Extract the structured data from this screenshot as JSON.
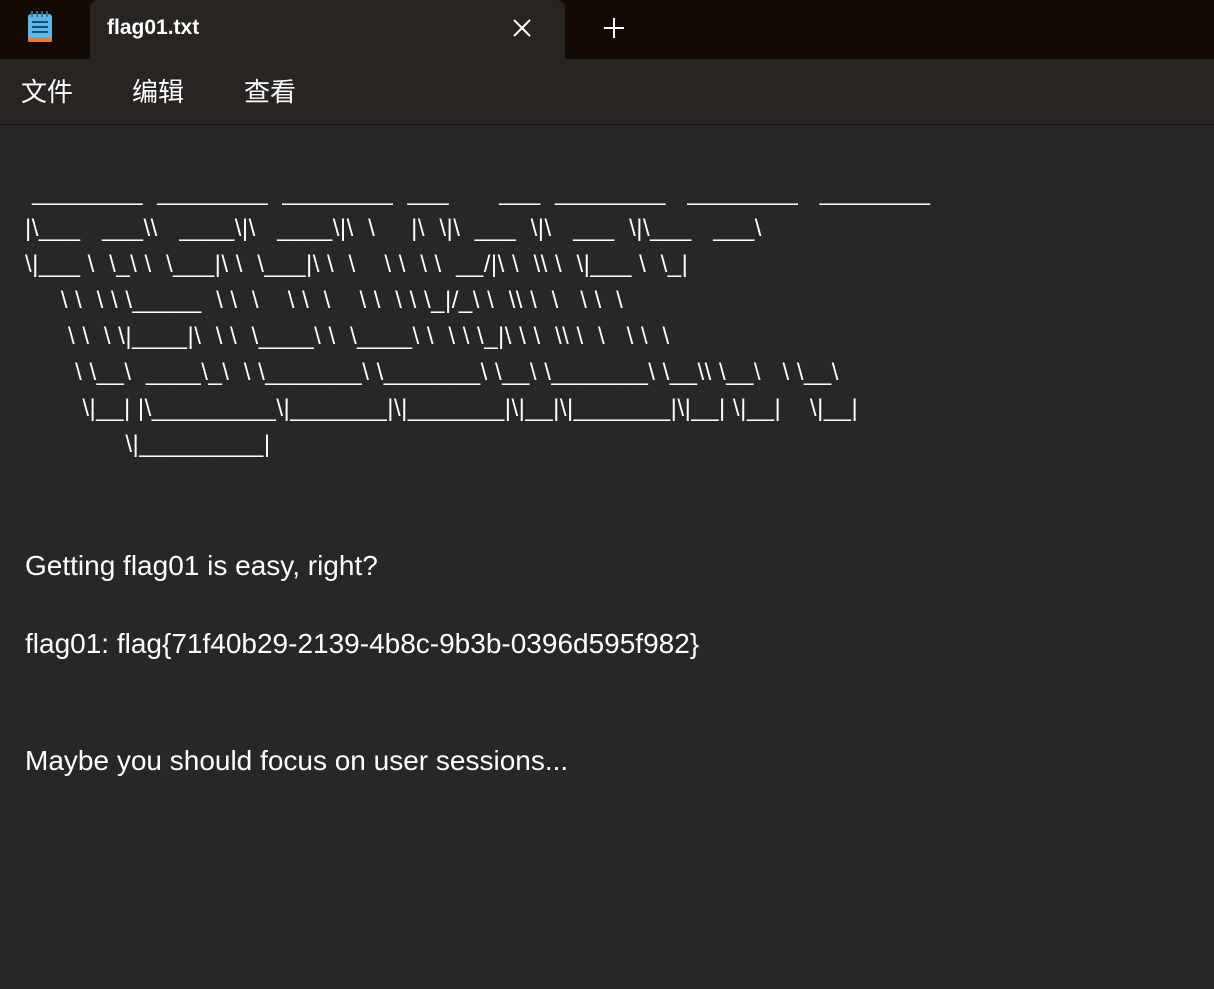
{
  "tab": {
    "title": "flag01.txt",
    "close_icon": "close-icon",
    "new_tab_icon": "plus-icon"
  },
  "menu": {
    "file": "文件",
    "edit": "编辑",
    "view": "查看"
  },
  "document": {
    "ascii_art": " ________  ________  ________  ___       ___  ________   ________   ________\n|\\___   ___\\\\   ____\\|\\   ____\\|\\  \\     |\\  \\|\\  ___  \\|\\   ___  \\|\\___   ___\\\n\\|___ \\  \\_\\ \\  \\___|\\ \\  \\___|\\ \\  \\    \\ \\  \\ \\  __/|\\ \\  \\\\ \\  \\|___ \\  \\_|\n     \\ \\  \\ \\ \\_____  \\ \\  \\    \\ \\  \\    \\ \\  \\ \\ \\_|/_\\ \\  \\\\ \\  \\   \\ \\  \\\n      \\ \\  \\ \\|____|\\  \\ \\  \\____\\ \\  \\____\\ \\  \\ \\ \\_|\\ \\ \\  \\\\ \\  \\   \\ \\  \\\n       \\ \\__\\  ____\\_\\  \\ \\_______\\ \\_______\\ \\__\\ \\_______\\ \\__\\\\ \\__\\   \\ \\__\\\n        \\|__| |\\_________\\|_______|\\|_______|\\|__|\\|_______|\\|__| \\|__|    \\|__|\n              \\|_________|",
    "line1": "Getting flag01 is easy, right?",
    "line2": "flag01: flag{71f40b29-2139-4b8c-9b3b-0396d595f982}",
    "line3": "Maybe you should focus on user sessions..."
  },
  "colors": {
    "titlebar_bg": "#140904",
    "tab_bg": "#272421",
    "editor_bg": "#272727",
    "text": "#ffffff"
  }
}
